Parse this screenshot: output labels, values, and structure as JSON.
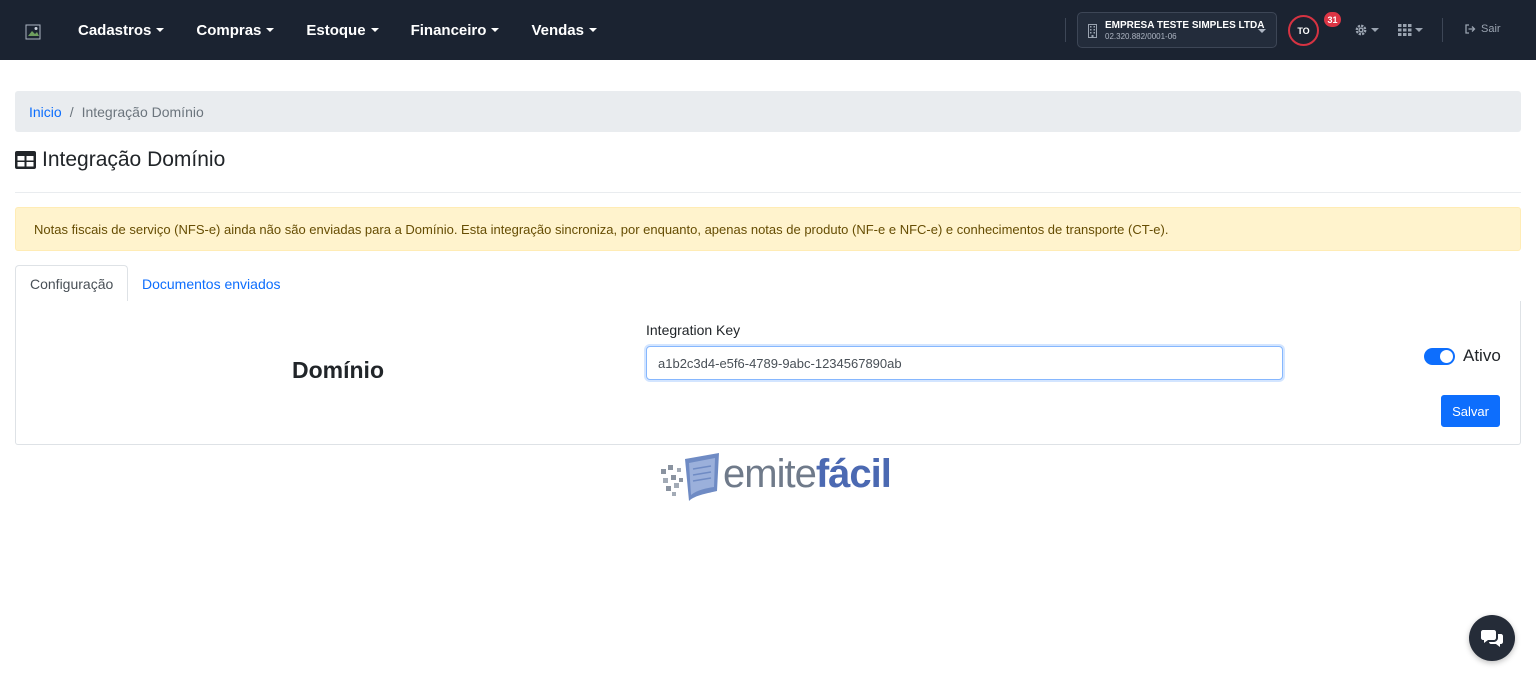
{
  "navbar": {
    "menu": [
      {
        "label": "Cadastros"
      },
      {
        "label": "Compras"
      },
      {
        "label": "Estoque"
      },
      {
        "label": "Financeiro"
      },
      {
        "label": "Vendas"
      }
    ],
    "company": {
      "name": "EMPRESA TESTE SIMPLES LTDA",
      "cnpj": "02.320.882/0001-06"
    },
    "avatar_initials": "TO",
    "notifications_count": "31",
    "logout_label": "Sair"
  },
  "breadcrumb": {
    "home": "Inicio",
    "current": "Integração Domínio"
  },
  "page": {
    "title": "Integração Domínio"
  },
  "alert": {
    "text": "Notas fiscais de serviço (NFS-e) ainda não são enviadas para a Domínio. Esta integração sincroniza, por enquanto, apenas notas de produto (NF-e e NFC-e) e conhecimentos de transporte (CT-e)."
  },
  "tabs": [
    {
      "label": "Configuração",
      "active": true
    },
    {
      "label": "Documentos enviados",
      "active": false
    }
  ],
  "config": {
    "provider_name": "Domínio",
    "integration_key_label": "Integration Key",
    "integration_key_value": "a1b2c3d4-e5f6-4789-9abc-1234567890ab",
    "toggle_label": "Ativo",
    "toggle_on": true,
    "save_label": "Salvar"
  },
  "brand": {
    "part1": "emite",
    "part2": "fácil"
  },
  "colors": {
    "navbar": "#1b2331",
    "primary": "#0d6efd",
    "alert_bg": "#fff3cd",
    "alert_text": "#664d03",
    "badge": "#dc3545",
    "brand_blue": "#4b69b2"
  }
}
